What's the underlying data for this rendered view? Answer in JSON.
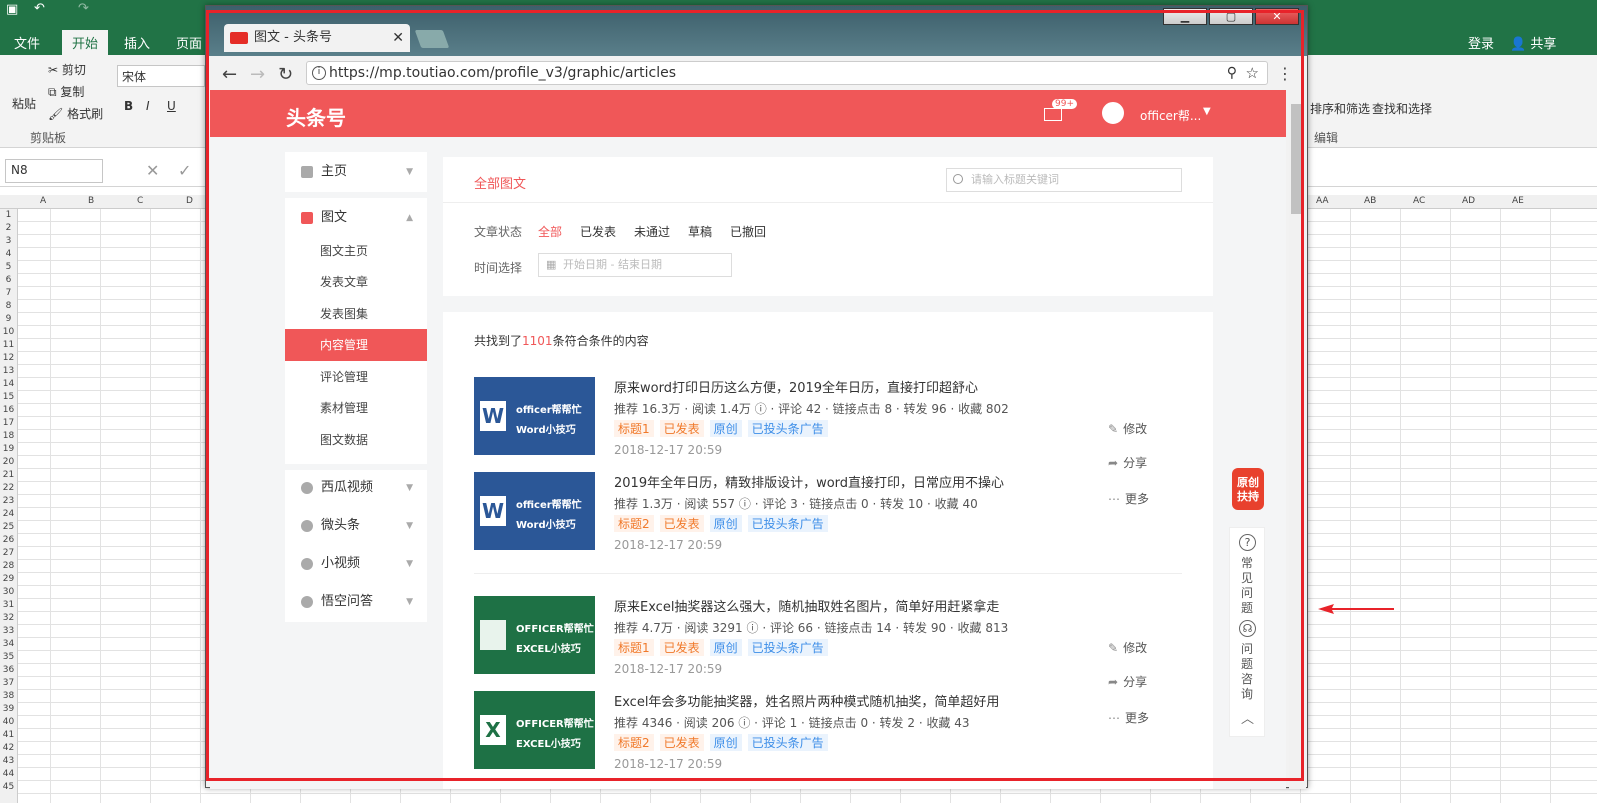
{
  "excel": {
    "tabs": [
      "文件",
      "开始",
      "插入",
      "页面"
    ],
    "account": {
      "login": "登录",
      "share": "共享"
    },
    "ribbon": {
      "paste": "粘贴",
      "cut": "剪切",
      "copy": "复制",
      "format_painter": "格式刷",
      "clipboard_group": "剪贴板",
      "font_name": "宋体",
      "sort_filter": "排序和筛选",
      "find_select": "查找和选择",
      "edit_group": "编辑"
    },
    "name_box": "N8",
    "columns_left": [
      "A",
      "B",
      "C",
      "D"
    ],
    "columns_right": [
      "AA",
      "AB",
      "AC",
      "AD",
      "AE"
    ],
    "rows": [
      "1",
      "2",
      "3",
      "4",
      "5",
      "6",
      "7",
      "8",
      "9",
      "10",
      "11",
      "12",
      "13",
      "14",
      "15",
      "16",
      "17",
      "18",
      "19",
      "20",
      "21",
      "22",
      "23",
      "24",
      "25",
      "26",
      "27",
      "28",
      "29",
      "30",
      "31",
      "32",
      "33",
      "34",
      "35",
      "36",
      "37",
      "38",
      "39",
      "40",
      "41",
      "42",
      "43",
      "44",
      "45"
    ]
  },
  "browser": {
    "tab_title": "图文 - 头条号",
    "url": "https://mp.toutiao.com/profile_v3/graphic/articles"
  },
  "site": {
    "logo": "头条号",
    "mail_badge": "99+",
    "username": "officer帮..."
  },
  "sidebar": {
    "home": "主页",
    "graphic": "图文",
    "graphic_sub": [
      "图文主页",
      "发表文章",
      "发表图集",
      "内容管理",
      "评论管理",
      "素材管理",
      "图文数据"
    ],
    "others": [
      "西瓜视频",
      "微头条",
      "小视频",
      "悟空问答"
    ]
  },
  "filter": {
    "all_tab": "全部图文",
    "search_placeholder": "请输入标题关键词",
    "status_label": "文章状态",
    "statuses": [
      "全部",
      "已发表",
      "未通过",
      "草稿",
      "已撤回"
    ],
    "time_label": "时间选择",
    "date_placeholder": "开始日期  -  结束日期"
  },
  "list": {
    "count_prefix": "共找到了",
    "count": "1101",
    "count_suffix": "条符合条件的内容",
    "articles": [
      {
        "title": "原来word打印日历这么方便，2019全年日历，直接打印超舒心",
        "stats": "推荐 16.3万 · 阅读 1.4万 ⓘ · 评论 42 · 链接点击 8 · 转发 96 · 收藏 802",
        "tag_title": "标题1",
        "time": "2018-12-17 20:59",
        "thumb_line1": "officer帮帮忙",
        "thumb_line2": "Word小技巧",
        "thumb_letter": "W"
      },
      {
        "title": "2019年全年日历，精致排版设计，word直接打印，日常应用不操心",
        "stats": "推荐 1.3万 · 阅读 557 ⓘ · 评论 3 · 链接点击 0 · 转发 10 · 收藏 40",
        "tag_title": "标题2",
        "time": "2018-12-17 20:59",
        "thumb_line1": "officer帮帮忙",
        "thumb_line2": "Word小技巧",
        "thumb_letter": "W"
      },
      {
        "title": "原来Excel抽奖器这么强大，随机抽取姓名图片，简单好用赶紧拿走",
        "stats": "推荐 4.7万 · 阅读 3291 ⓘ · 评论 66 · 链接点击 14 · 转发 90 · 收藏 813",
        "tag_title": "标题1",
        "time": "2018-12-17 20:59",
        "thumb_line1": "OFFICER帮帮忙",
        "thumb_line2": "EXCEL小技巧",
        "thumb_letter": ""
      },
      {
        "title": "Excel年会多功能抽奖器，姓名照片两种模式随机抽奖，简单超好用",
        "stats": "推荐 4346 · 阅读 206 ⓘ · 评论 1 · 链接点击 0 · 转发 2 · 收藏 43",
        "tag_title": "标题2",
        "time": "2018-12-17 20:59",
        "thumb_line1": "OFFICER帮帮忙",
        "thumb_line2": "EXCEL小技巧",
        "thumb_letter": "X"
      }
    ],
    "tag_published": "已发表",
    "tag_original": "原创",
    "tag_ad": "已投头条广告",
    "actions": {
      "edit": "修改",
      "share": "分享",
      "more": "更多"
    }
  },
  "float": {
    "original_badge": "原创扶持",
    "faq": "常见问题",
    "consult": "问题咨询"
  },
  "colors": {
    "brand": "#f05758",
    "excel": "#217346"
  }
}
